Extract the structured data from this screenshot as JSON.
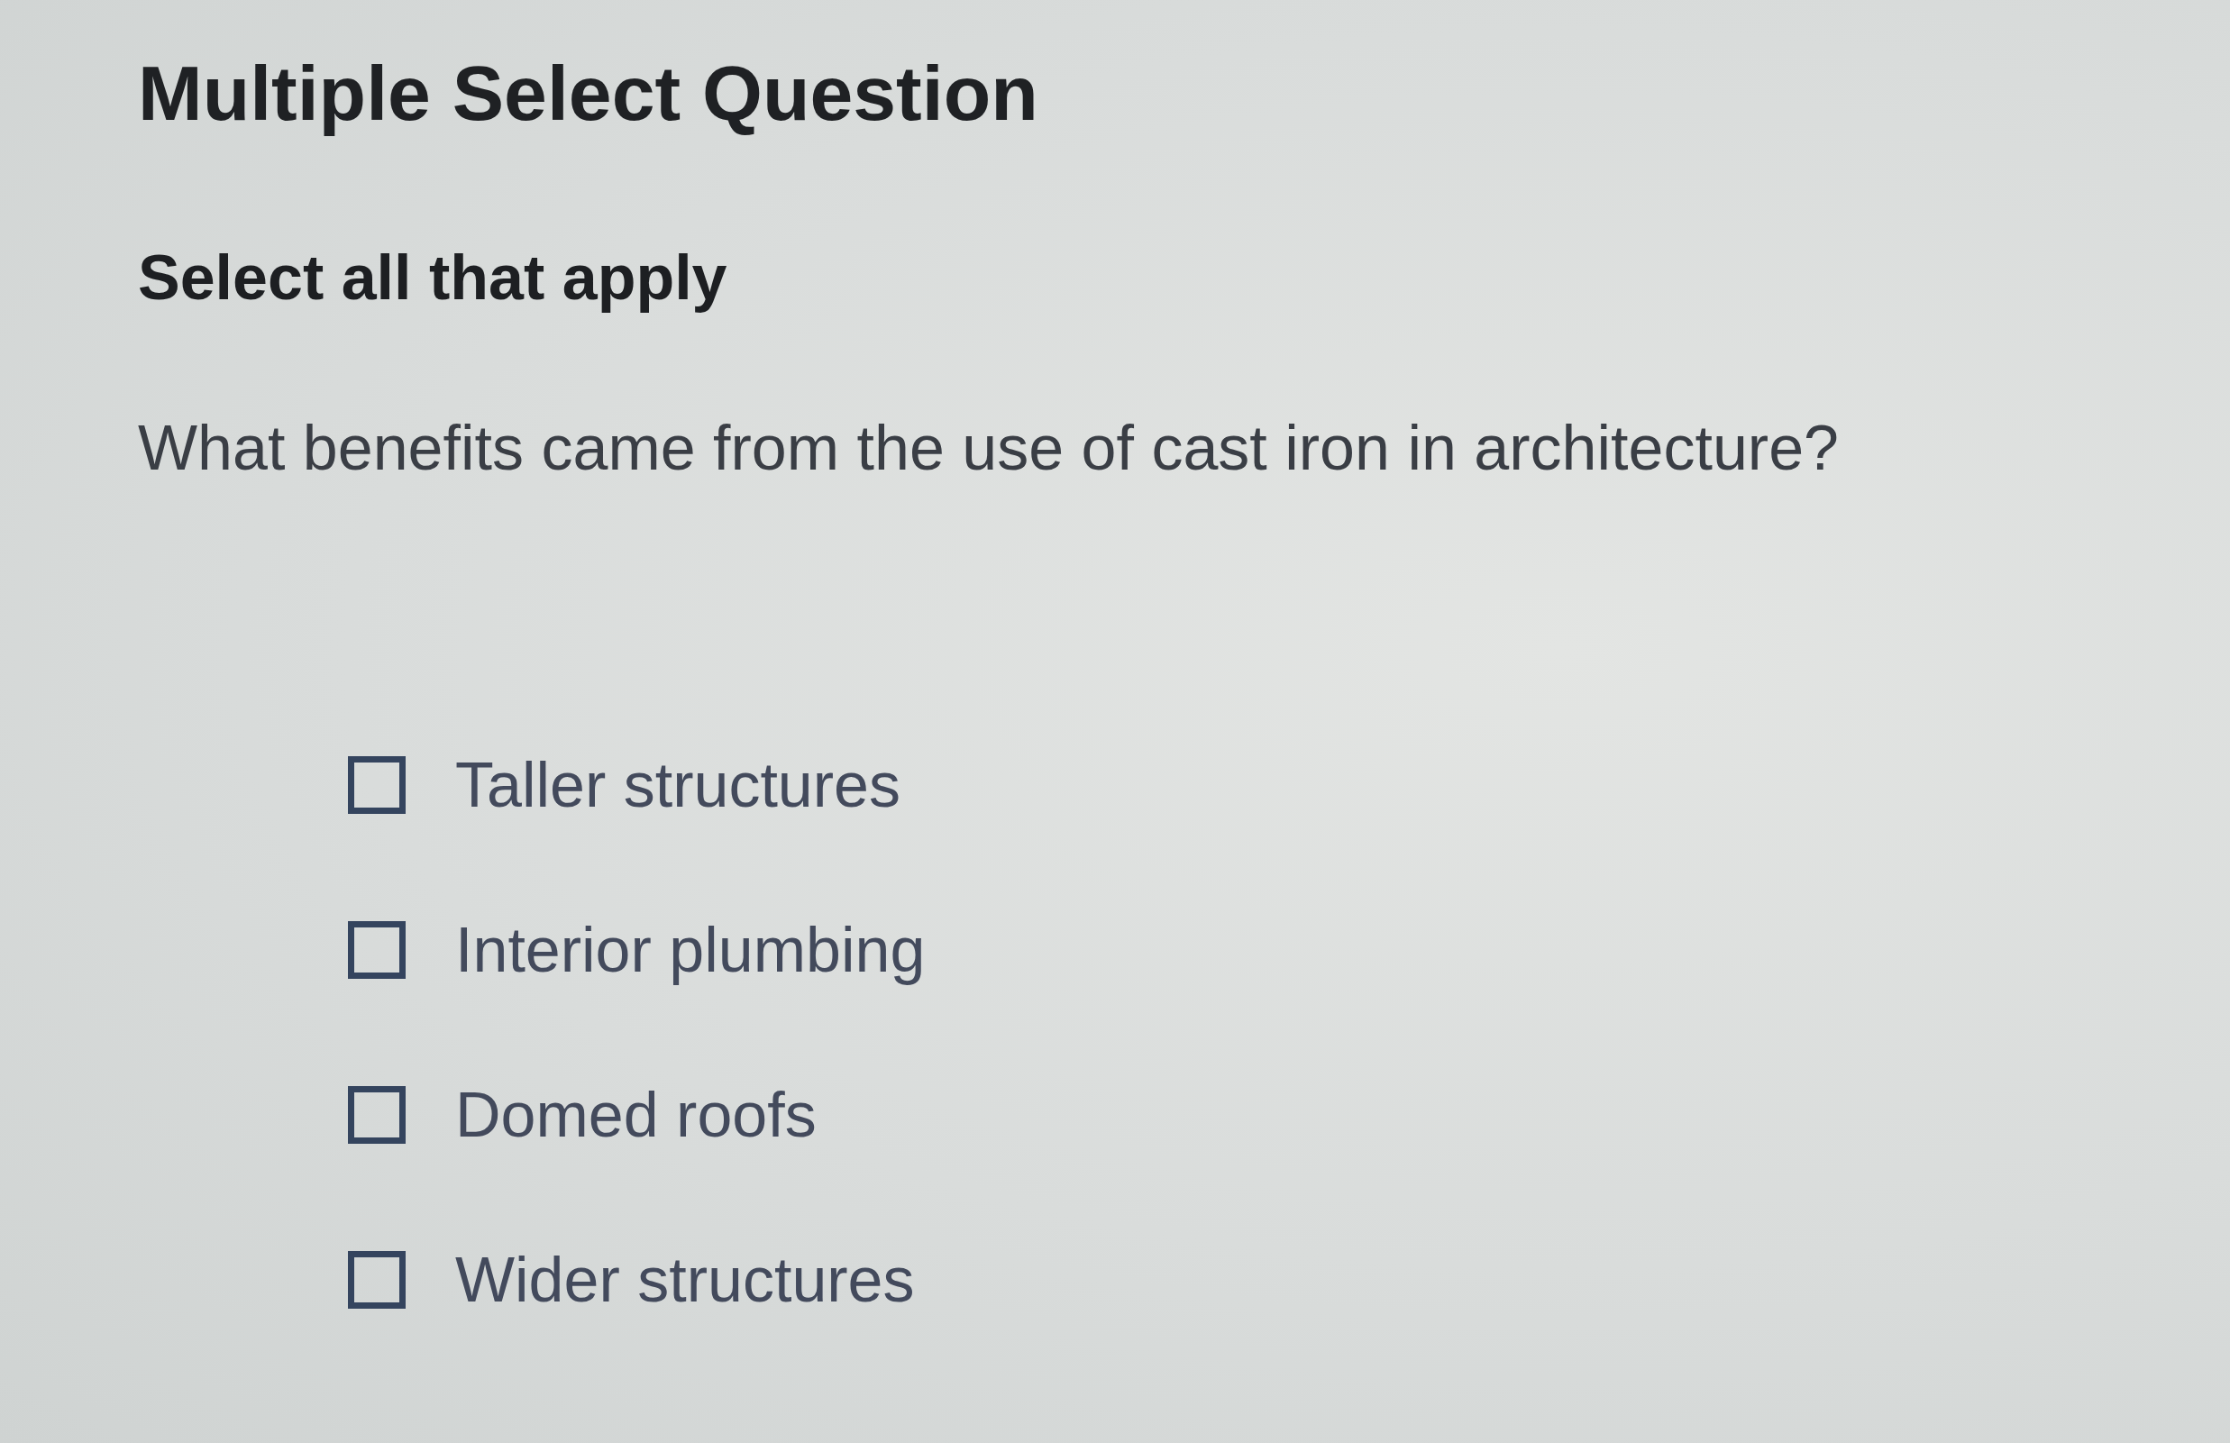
{
  "title": "Multiple Select Question",
  "instruction": "Select all that apply",
  "question": "What benefits came from the use of cast iron in architecture?",
  "options": [
    {
      "label": "Taller structures",
      "checked": false
    },
    {
      "label": "Interior plumbing",
      "checked": false
    },
    {
      "label": "Domed roofs",
      "checked": false
    },
    {
      "label": "Wider structures",
      "checked": false
    }
  ]
}
